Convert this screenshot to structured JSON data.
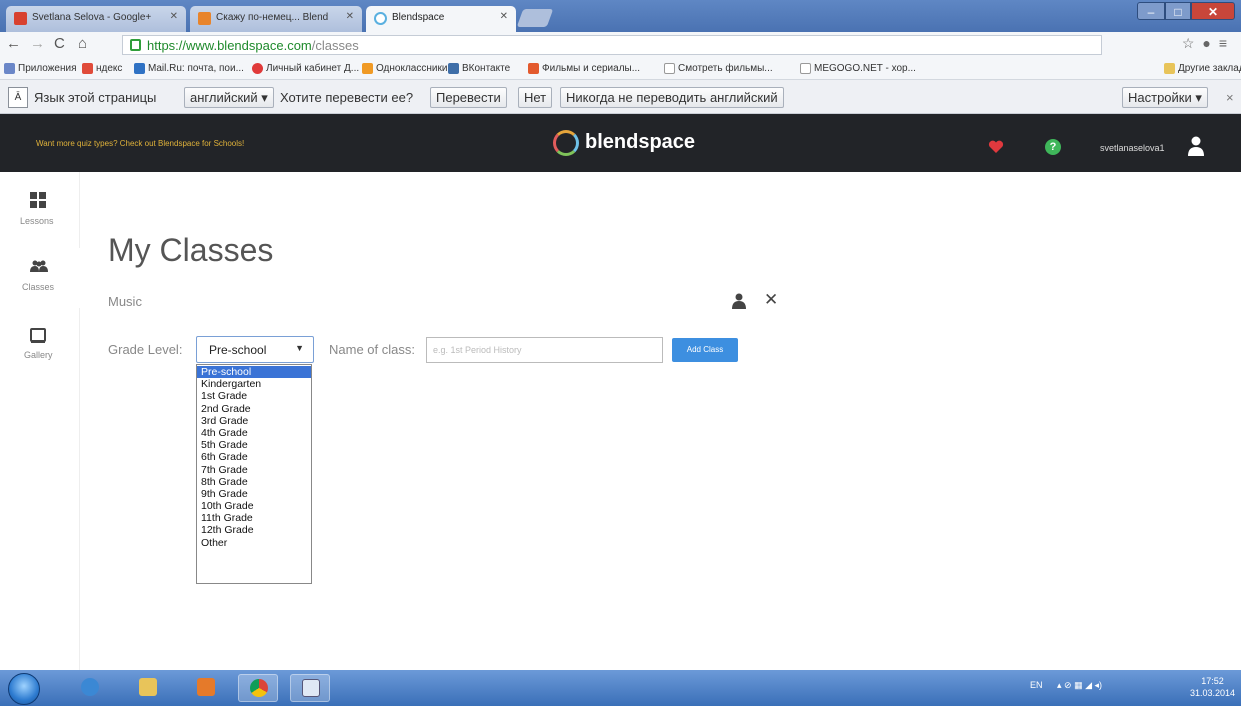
{
  "browser": {
    "tabs": [
      {
        "label": "Svetlana Selova - Google+",
        "active": false
      },
      {
        "label": "Скажу по-немец... Blend",
        "active": false
      },
      {
        "label": "Blendspace",
        "active": true
      }
    ],
    "url_host": "https://www.blendspace.com",
    "url_path": "/classes",
    "bookmarks": [
      {
        "label": "Приложения"
      },
      {
        "label": "ндекс"
      },
      {
        "label": "Mail.Ru: почта, пои..."
      },
      {
        "label": "Личный кабинет Д..."
      },
      {
        "label": "Одноклассники"
      },
      {
        "label": "ВКонтакте"
      },
      {
        "label": "Фильмы и сериалы..."
      },
      {
        "label": "Смотреть фильмы..."
      },
      {
        "label": "MEGOGO.NET - хор..."
      },
      {
        "label": "Другие закладки"
      }
    ]
  },
  "translate_bar": {
    "page_language_label": "Язык этой страницы",
    "language_value": "английский",
    "question": "Хотите перевести ее?",
    "translate_button": "Перевести",
    "no_button": "Нет",
    "never_button": "Никогда не переводить английский",
    "settings_button": "Настройки"
  },
  "header": {
    "promo": "Want more quiz types? Check out Blendspace for Schools!",
    "brand": "blendspace",
    "username": "svetlanaselova1",
    "colors": {
      "heart": "#e0393e",
      "help": "#3fb65a"
    }
  },
  "sidebar": {
    "items": [
      {
        "label": "Lessons",
        "icon": "grid-icon"
      },
      {
        "label": "Classes",
        "icon": "people-icon"
      },
      {
        "label": "Gallery",
        "icon": "square-icon"
      }
    ]
  },
  "main": {
    "title": "My Classes",
    "class_name": "Music",
    "grade_label": "Grade Level:",
    "grade_selected": "Pre-school",
    "name_label": "Name of class:",
    "name_placeholder": "e.g. 1st Period History",
    "add_button": "Add Class",
    "grade_options": [
      "Pre-school",
      "Kindergarten",
      "1st Grade",
      "2nd Grade",
      "3rd Grade",
      "4th Grade",
      "5th Grade",
      "6th Grade",
      "7th Grade",
      "8th Grade",
      "9th Grade",
      "10th Grade",
      "11th Grade",
      "12th Grade",
      "Other"
    ]
  },
  "taskbar": {
    "language": "EN",
    "time": "17:52",
    "date": "31.03.2014"
  }
}
